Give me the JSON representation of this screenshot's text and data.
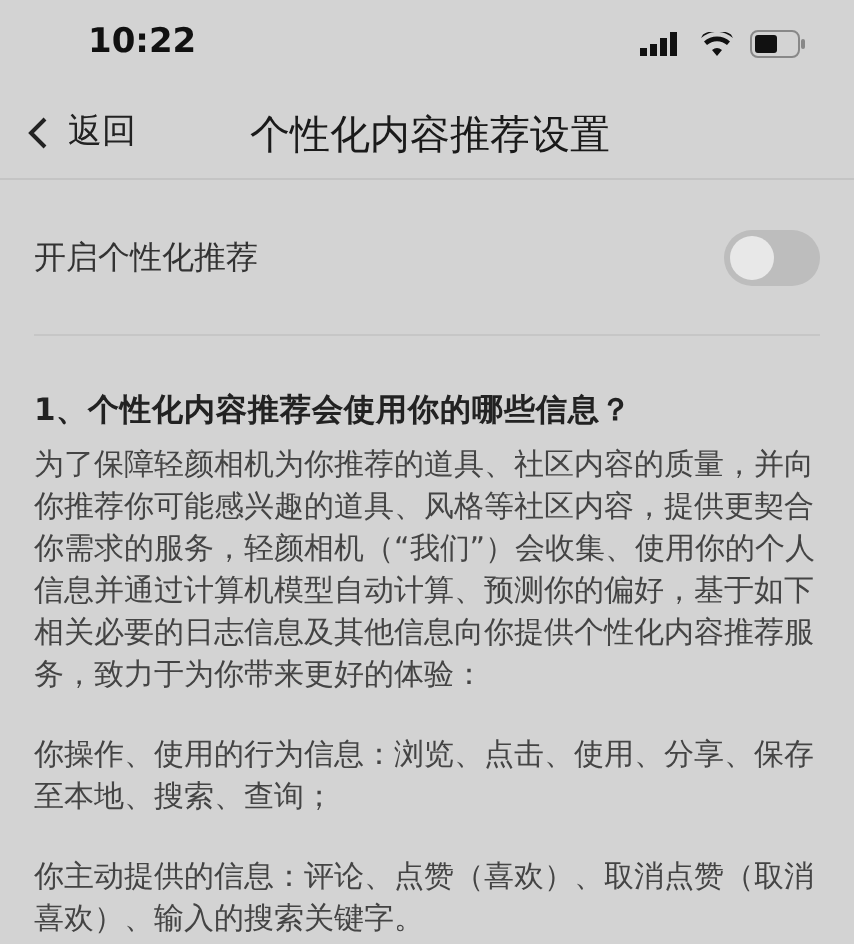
{
  "status_bar": {
    "time": "10:22"
  },
  "nav": {
    "back": "返回",
    "title": "个性化内容推荐设置"
  },
  "setting": {
    "label": "开启个性化推荐",
    "on": false
  },
  "section": {
    "heading": "1、个性化内容推荐会使用你的哪些信息？",
    "paragraphs": [
      "为了保障轻颜相机为你推荐的道具、社区内容的质量，并向你推荐你可能感兴趣的道具、风格等社区内容，提供更契合你需求的服务，轻颜相机（“我们”）会收集、使用你的个人信息并通过计算机模型自动计算、预测你的偏好，基于如下相关必要的日志信息及其他信息向你提供个性化内容推荐服务，致力于为你带来更好的体验：",
      "你操作、使用的行为信息：浏览、点击、使用、分享、保存至本地、搜索、查询；",
      "你主动提供的信息：评论、点赞（喜欢）、取消点赞（取消喜欢）、输入的搜索关键字。"
    ]
  }
}
